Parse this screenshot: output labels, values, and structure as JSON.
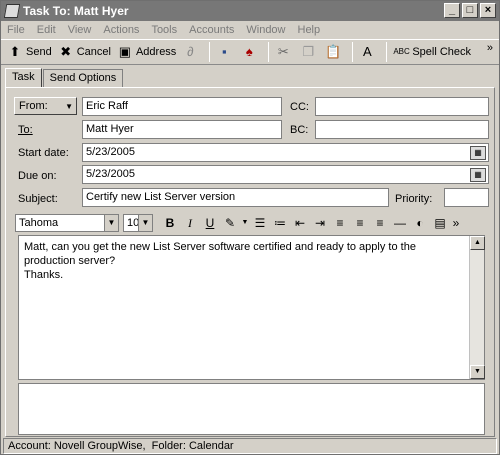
{
  "window": {
    "title": "Task To: Matt Hyer"
  },
  "menu": [
    "File",
    "Edit",
    "View",
    "Actions",
    "Tools",
    "Accounts",
    "Window",
    "Help"
  ],
  "toolbar": {
    "send": "Send",
    "cancel": "Cancel",
    "address": "Address",
    "spell": "Spell Check",
    "more": "»"
  },
  "tabs": [
    {
      "label": "Task",
      "active": true
    },
    {
      "label": "Send Options",
      "active": false
    }
  ],
  "form": {
    "from_label": "From:",
    "from_value": "Eric Raff",
    "to_label": "To:",
    "to_value": "Matt Hyer",
    "cc_label": "CC:",
    "cc_value": "",
    "bc_label": "BC:",
    "bc_value": "",
    "start_label": "Start date:",
    "start_value": "5/23/2005",
    "due_label": "Due on:",
    "due_value": "5/23/2005",
    "subject_label": "Subject:",
    "subject_value": "Certify new List Server version",
    "priority_label": "Priority:",
    "priority_value": ""
  },
  "format": {
    "font": "Tahoma",
    "size": "10",
    "bold": "B",
    "italic": "I",
    "underline": "U"
  },
  "body": {
    "line1": "Matt, can you get the new List Server software certified and ready to apply to the",
    "line2": "production server?",
    "line3": "Thanks."
  },
  "status": {
    "text": "Account: Novell GroupWise,  Folder: Calendar"
  },
  "colors": {
    "titlebar": "#777777",
    "chrome": "#d4d0c8"
  }
}
